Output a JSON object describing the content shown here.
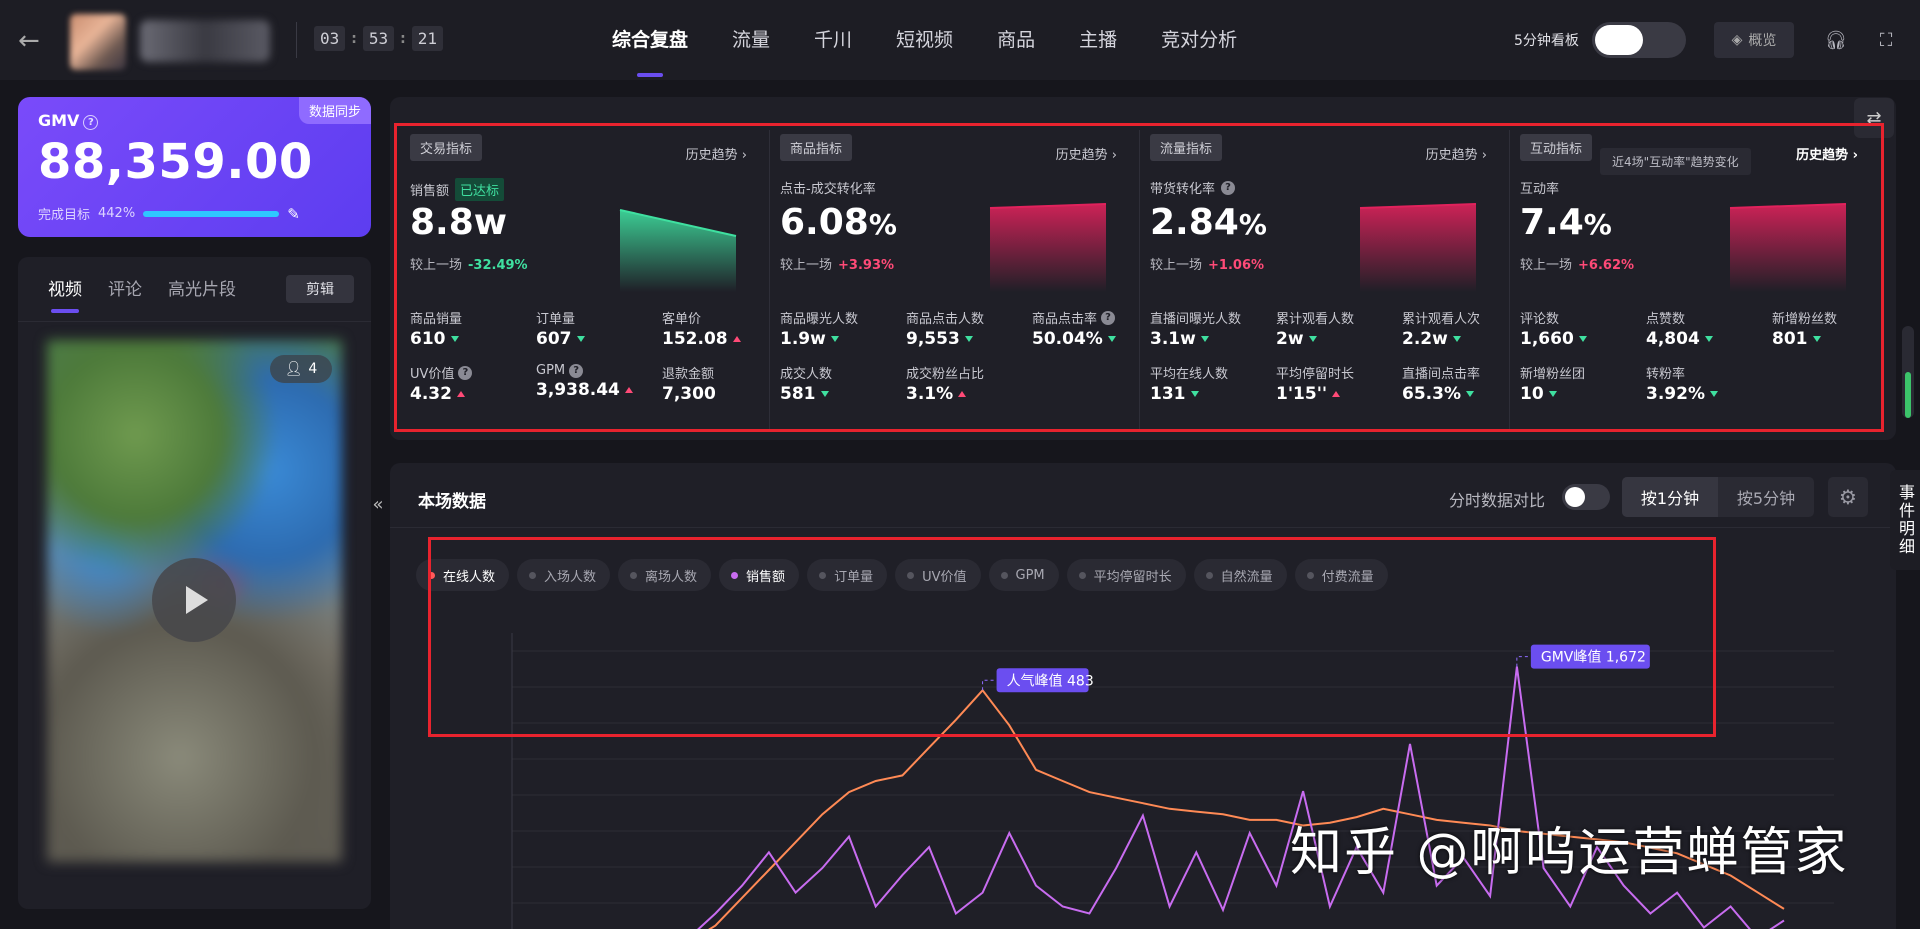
{
  "timer": {
    "h": "03",
    "m": "53",
    "s": "21"
  },
  "nav": [
    "综合复盘",
    "流量",
    "千川",
    "短视频",
    "商品",
    "主播",
    "竞对分析"
  ],
  "header": {
    "five_min_board": "5分钟看板",
    "overview": "概览"
  },
  "gmv": {
    "label": "GMV",
    "value": "88,359.00",
    "target_label": "完成目标",
    "target_pct": "442%",
    "sync": "数据同步"
  },
  "video_panel": {
    "tabs": [
      "视频",
      "评论",
      "高光片段"
    ],
    "clip_button": "剪辑",
    "viewers": "4"
  },
  "metrics": [
    {
      "tag": "交易指标",
      "history": "历史趋势 ›",
      "main_label": "销售额",
      "badge": "已达标",
      "main_value": "8.8w",
      "cmp_label": "较上一场",
      "cmp_value": "-32.49%",
      "cmp_dir": "down",
      "spark_color": "#3fe0a0",
      "spark_trend": "down",
      "cells": [
        {
          "label": "商品销量",
          "value": "610",
          "dir": "down"
        },
        {
          "label": "订单量",
          "value": "607",
          "dir": "down"
        },
        {
          "label": "客单价",
          "value": "152.08",
          "dir": "up"
        },
        {
          "label": "UV价值",
          "value": "4.32",
          "dir": "up",
          "q": true
        },
        {
          "label": "GPM",
          "value": "3,938.44",
          "dir": "up",
          "q": true
        },
        {
          "label": "退款金额",
          "value": "7,300",
          "dir": ""
        }
      ]
    },
    {
      "tag": "商品指标",
      "history": "历史趋势 ›",
      "main_label": "点击-成交转化率",
      "main_value": "6.08",
      "main_unit": "%",
      "cmp_label": "较上一场",
      "cmp_value": "+3.93%",
      "cmp_dir": "up",
      "spark_color": "#e0225c",
      "spark_trend": "flat",
      "cells": [
        {
          "label": "商品曝光人数",
          "value": "1.9w",
          "dir": "down"
        },
        {
          "label": "商品点击人数",
          "value": "9,553",
          "dir": "down"
        },
        {
          "label": "商品点击率",
          "value": "50.04%",
          "dir": "down",
          "q": true
        },
        {
          "label": "成交人数",
          "value": "581",
          "dir": "down"
        },
        {
          "label": "成交粉丝占比",
          "value": "3.1%",
          "dir": "up"
        }
      ]
    },
    {
      "tag": "流量指标",
      "history": "历史趋势 ›",
      "main_label": "带货转化率",
      "main_q": true,
      "main_value": "2.84",
      "main_unit": "%",
      "cmp_label": "较上一场",
      "cmp_value": "+1.06%",
      "cmp_dir": "up",
      "spark_color": "#e0225c",
      "spark_trend": "flat",
      "cells": [
        {
          "label": "直播间曝光人数",
          "value": "3.1w",
          "dir": "down"
        },
        {
          "label": "累计观看人数",
          "value": "2w",
          "dir": "down"
        },
        {
          "label": "累计观看人次",
          "value": "2.2w",
          "dir": "down"
        },
        {
          "label": "平均在线人数",
          "value": "131",
          "dir": "down"
        },
        {
          "label": "平均停留时长",
          "value": "1'15''",
          "dir": "up"
        },
        {
          "label": "直播间点击率",
          "value": "65.3%",
          "dir": "down"
        }
      ]
    },
    {
      "tag": "互动指标",
      "history": "历史趋势 ›",
      "tip": "近4场\"互动率\"趋势变化",
      "main_label": "互动率",
      "main_value": "7.4",
      "main_unit": "%",
      "cmp_label": "较上一场",
      "cmp_value": "+6.62%",
      "cmp_dir": "up",
      "spark_color": "#e0225c",
      "spark_trend": "flat",
      "cells": [
        {
          "label": "评论数",
          "value": "1,660",
          "dir": "down"
        },
        {
          "label": "点赞数",
          "value": "4,804",
          "dir": "down"
        },
        {
          "label": "新增粉丝数",
          "value": "801",
          "dir": "down"
        },
        {
          "label": "新增粉丝团",
          "value": "10",
          "dir": "down"
        },
        {
          "label": "转粉率",
          "value": "3.92%",
          "dir": "down"
        }
      ]
    }
  ],
  "session": {
    "title": "本场数据",
    "compare_label": "分时数据对比",
    "gran": [
      "按1分钟",
      "按5分钟"
    ],
    "legend": [
      {
        "label": "在线人数",
        "on": true,
        "color": "#ff5a5a"
      },
      {
        "label": "入场人数",
        "on": false
      },
      {
        "label": "离场人数",
        "on": false
      },
      {
        "label": "销售额",
        "on": true,
        "color": "#c86cf0"
      },
      {
        "label": "订单量",
        "on": false
      },
      {
        "label": "UV价值",
        "on": false
      },
      {
        "label": "GPM",
        "on": false
      },
      {
        "label": "平均停留时长",
        "on": false
      },
      {
        "label": "自然流量",
        "on": false
      },
      {
        "label": "付费流量",
        "on": false
      }
    ]
  },
  "chart_data": {
    "type": "line",
    "series": [
      {
        "name": "在线人数",
        "color": "#ff8a55",
        "values": [
          0,
          30,
          60,
          110,
          160,
          210,
          260,
          300,
          320,
          330,
          380,
          430,
          483,
          420,
          340,
          320,
          300,
          290,
          280,
          270,
          265,
          260,
          250,
          250,
          240,
          245,
          255,
          270,
          260,
          250,
          245,
          240,
          230,
          225,
          220,
          215,
          210,
          200,
          190,
          170,
          150,
          120,
          90
        ]
      },
      {
        "name": "销售额",
        "color": "#c86cf0",
        "values": [
          0,
          120,
          260,
          420,
          610,
          380,
          520,
          700,
          300,
          480,
          640,
          260,
          380,
          720,
          420,
          300,
          260,
          520,
          820,
          300,
          610,
          280,
          720,
          420,
          960,
          300,
          640,
          380,
          1230,
          420,
          580,
          360,
          1672,
          520,
          300,
          640,
          420,
          260,
          380,
          180,
          300,
          120,
          220
        ]
      }
    ],
    "annotations": [
      {
        "text": "人气峰值 483",
        "series": 0,
        "index": 12
      },
      {
        "text": "GMV峰值 1,672",
        "series": 1,
        "index": 32
      }
    ]
  },
  "watermark": "知乎 @啊呜运营蝉管家",
  "events_tab": "事件明细"
}
